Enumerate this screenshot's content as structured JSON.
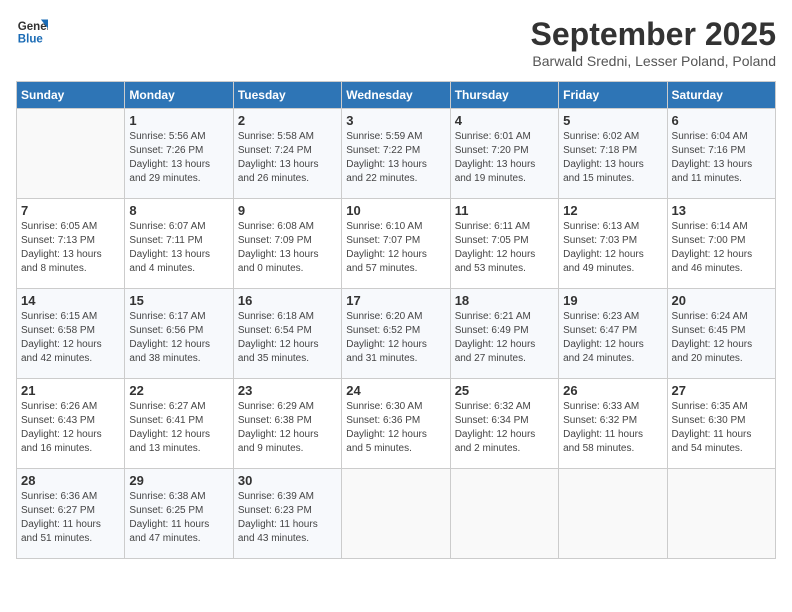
{
  "logo": {
    "line1": "General",
    "line2": "Blue"
  },
  "title": "September 2025",
  "location": "Barwald Sredni, Lesser Poland, Poland",
  "headers": [
    "Sunday",
    "Monday",
    "Tuesday",
    "Wednesday",
    "Thursday",
    "Friday",
    "Saturday"
  ],
  "weeks": [
    [
      {
        "day": "",
        "info": ""
      },
      {
        "day": "1",
        "info": "Sunrise: 5:56 AM\nSunset: 7:26 PM\nDaylight: 13 hours\nand 29 minutes."
      },
      {
        "day": "2",
        "info": "Sunrise: 5:58 AM\nSunset: 7:24 PM\nDaylight: 13 hours\nand 26 minutes."
      },
      {
        "day": "3",
        "info": "Sunrise: 5:59 AM\nSunset: 7:22 PM\nDaylight: 13 hours\nand 22 minutes."
      },
      {
        "day": "4",
        "info": "Sunrise: 6:01 AM\nSunset: 7:20 PM\nDaylight: 13 hours\nand 19 minutes."
      },
      {
        "day": "5",
        "info": "Sunrise: 6:02 AM\nSunset: 7:18 PM\nDaylight: 13 hours\nand 15 minutes."
      },
      {
        "day": "6",
        "info": "Sunrise: 6:04 AM\nSunset: 7:16 PM\nDaylight: 13 hours\nand 11 minutes."
      }
    ],
    [
      {
        "day": "7",
        "info": "Sunrise: 6:05 AM\nSunset: 7:13 PM\nDaylight: 13 hours\nand 8 minutes."
      },
      {
        "day": "8",
        "info": "Sunrise: 6:07 AM\nSunset: 7:11 PM\nDaylight: 13 hours\nand 4 minutes."
      },
      {
        "day": "9",
        "info": "Sunrise: 6:08 AM\nSunset: 7:09 PM\nDaylight: 13 hours\nand 0 minutes."
      },
      {
        "day": "10",
        "info": "Sunrise: 6:10 AM\nSunset: 7:07 PM\nDaylight: 12 hours\nand 57 minutes."
      },
      {
        "day": "11",
        "info": "Sunrise: 6:11 AM\nSunset: 7:05 PM\nDaylight: 12 hours\nand 53 minutes."
      },
      {
        "day": "12",
        "info": "Sunrise: 6:13 AM\nSunset: 7:03 PM\nDaylight: 12 hours\nand 49 minutes."
      },
      {
        "day": "13",
        "info": "Sunrise: 6:14 AM\nSunset: 7:00 PM\nDaylight: 12 hours\nand 46 minutes."
      }
    ],
    [
      {
        "day": "14",
        "info": "Sunrise: 6:15 AM\nSunset: 6:58 PM\nDaylight: 12 hours\nand 42 minutes."
      },
      {
        "day": "15",
        "info": "Sunrise: 6:17 AM\nSunset: 6:56 PM\nDaylight: 12 hours\nand 38 minutes."
      },
      {
        "day": "16",
        "info": "Sunrise: 6:18 AM\nSunset: 6:54 PM\nDaylight: 12 hours\nand 35 minutes."
      },
      {
        "day": "17",
        "info": "Sunrise: 6:20 AM\nSunset: 6:52 PM\nDaylight: 12 hours\nand 31 minutes."
      },
      {
        "day": "18",
        "info": "Sunrise: 6:21 AM\nSunset: 6:49 PM\nDaylight: 12 hours\nand 27 minutes."
      },
      {
        "day": "19",
        "info": "Sunrise: 6:23 AM\nSunset: 6:47 PM\nDaylight: 12 hours\nand 24 minutes."
      },
      {
        "day": "20",
        "info": "Sunrise: 6:24 AM\nSunset: 6:45 PM\nDaylight: 12 hours\nand 20 minutes."
      }
    ],
    [
      {
        "day": "21",
        "info": "Sunrise: 6:26 AM\nSunset: 6:43 PM\nDaylight: 12 hours\nand 16 minutes."
      },
      {
        "day": "22",
        "info": "Sunrise: 6:27 AM\nSunset: 6:41 PM\nDaylight: 12 hours\nand 13 minutes."
      },
      {
        "day": "23",
        "info": "Sunrise: 6:29 AM\nSunset: 6:38 PM\nDaylight: 12 hours\nand 9 minutes."
      },
      {
        "day": "24",
        "info": "Sunrise: 6:30 AM\nSunset: 6:36 PM\nDaylight: 12 hours\nand 5 minutes."
      },
      {
        "day": "25",
        "info": "Sunrise: 6:32 AM\nSunset: 6:34 PM\nDaylight: 12 hours\nand 2 minutes."
      },
      {
        "day": "26",
        "info": "Sunrise: 6:33 AM\nSunset: 6:32 PM\nDaylight: 11 hours\nand 58 minutes."
      },
      {
        "day": "27",
        "info": "Sunrise: 6:35 AM\nSunset: 6:30 PM\nDaylight: 11 hours\nand 54 minutes."
      }
    ],
    [
      {
        "day": "28",
        "info": "Sunrise: 6:36 AM\nSunset: 6:27 PM\nDaylight: 11 hours\nand 51 minutes."
      },
      {
        "day": "29",
        "info": "Sunrise: 6:38 AM\nSunset: 6:25 PM\nDaylight: 11 hours\nand 47 minutes."
      },
      {
        "day": "30",
        "info": "Sunrise: 6:39 AM\nSunset: 6:23 PM\nDaylight: 11 hours\nand 43 minutes."
      },
      {
        "day": "",
        "info": ""
      },
      {
        "day": "",
        "info": ""
      },
      {
        "day": "",
        "info": ""
      },
      {
        "day": "",
        "info": ""
      }
    ]
  ]
}
